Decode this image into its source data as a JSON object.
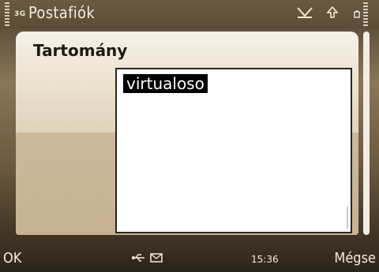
{
  "status": {
    "network": "3G",
    "title": "Postafiók",
    "icons": [
      "signal-strength-icon",
      "envelope-check-icon",
      "upload-arrow-icon",
      "battery-level-icon"
    ]
  },
  "form": {
    "label": "Tartomány",
    "value": "virtualoso"
  },
  "softkeys": {
    "left": "OK",
    "right": "Mégse",
    "clock": "15:36",
    "icons": [
      "usb-icon",
      "mail-icon"
    ]
  }
}
